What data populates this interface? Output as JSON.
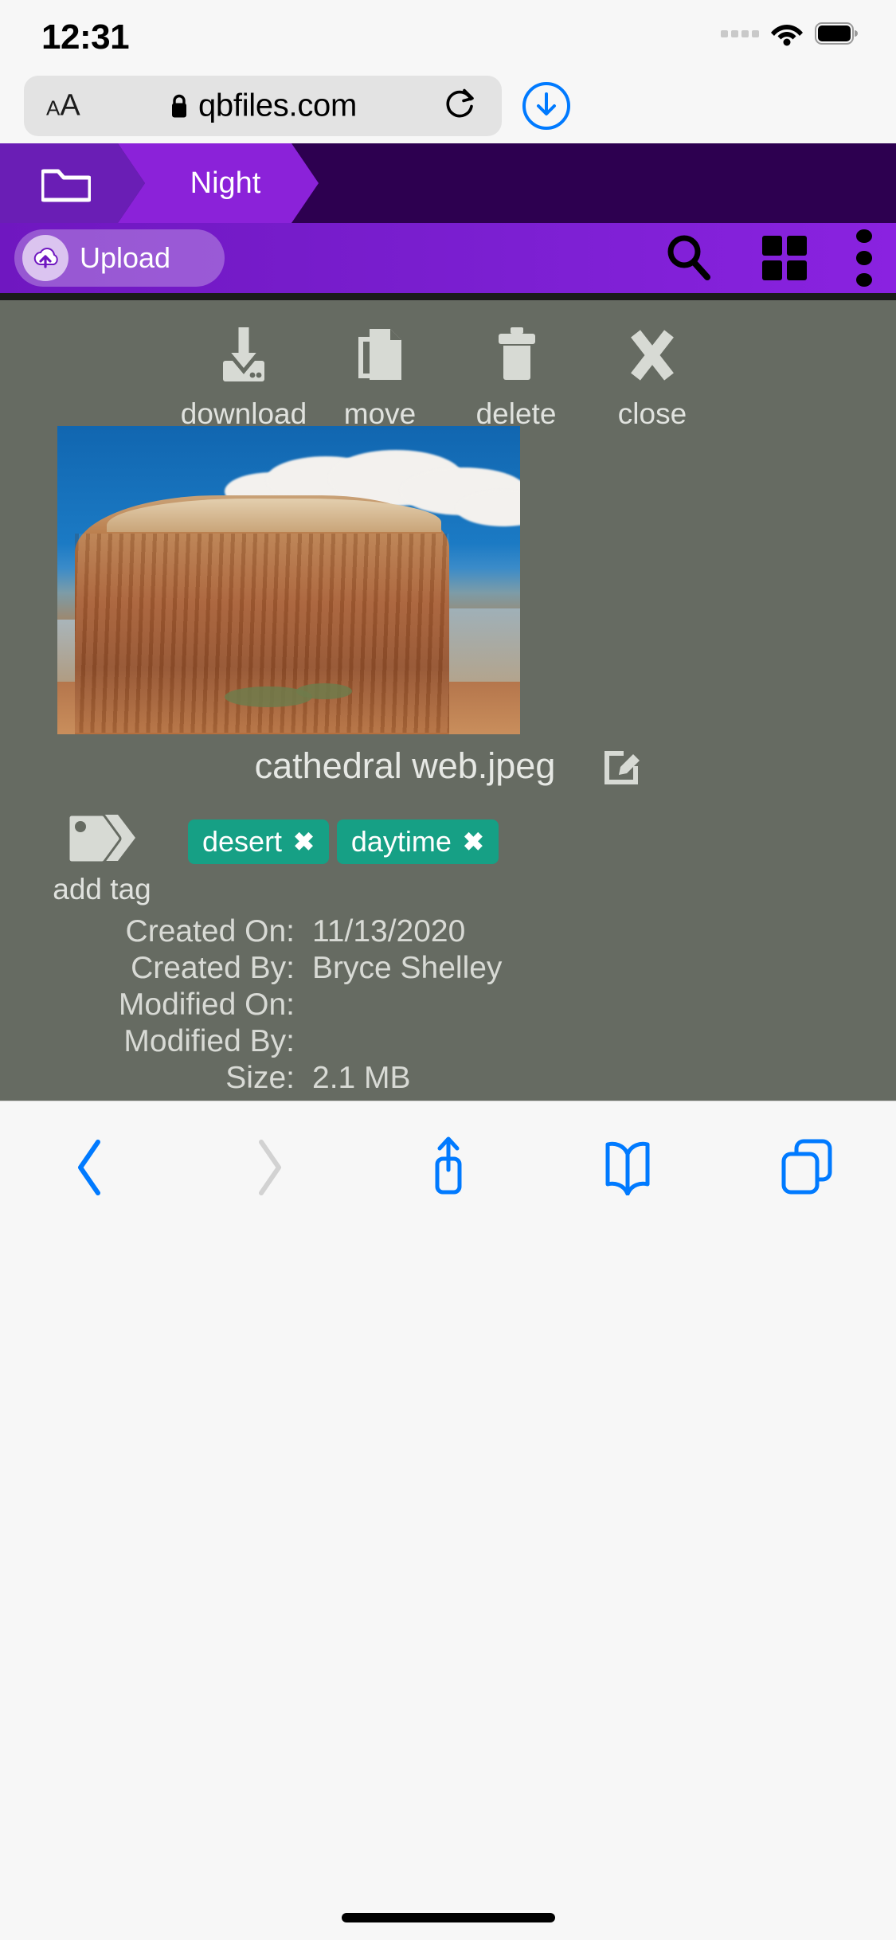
{
  "status_bar": {
    "time": "12:31",
    "wifi_icon": "wifi-icon",
    "battery_icon": "battery-icon",
    "signal_icon": "signal-dots-icon"
  },
  "browser": {
    "text_size_label_small": "A",
    "text_size_label_large": "A",
    "lock_icon": "lock-icon",
    "url": "qbfiles.com",
    "reload_icon": "reload-icon",
    "downloads_icon": "downloads-icon"
  },
  "breadcrumb": {
    "home_icon": "folder-icon",
    "items": [
      {
        "label": "Night"
      }
    ]
  },
  "app_toolbar": {
    "upload_label": "Upload",
    "upload_icon": "cloud-upload-icon",
    "search_icon": "search-icon",
    "grid_icon": "grid-view-icon",
    "menu_icon": "kebab-menu-icon"
  },
  "file_actions": [
    {
      "label": "download",
      "icon": "download-icon"
    },
    {
      "label": "move",
      "icon": "copy-move-icon"
    },
    {
      "label": "delete",
      "icon": "trash-icon"
    },
    {
      "label": "close",
      "icon": "close-x-icon"
    }
  ],
  "file": {
    "name": "cathedral web.jpeg",
    "edit_icon": "edit-pencil-icon",
    "preview_icon": "image-preview",
    "add_tag_label": "add tag",
    "add_tag_icon": "tags-icon",
    "tags": [
      {
        "label": "desert",
        "remove_icon": "remove-tag-icon"
      },
      {
        "label": "daytime",
        "remove_icon": "remove-tag-icon"
      }
    ],
    "metadata": [
      {
        "key": "Created On:",
        "value": "11/13/2020"
      },
      {
        "key": "Created By:",
        "value": "Bryce Shelley"
      },
      {
        "key": "Modified On:",
        "value": ""
      },
      {
        "key": "Modified By:",
        "value": ""
      },
      {
        "key": "Size:",
        "value": "2.1 MB"
      }
    ]
  },
  "safari_toolbar": {
    "back_icon": "back-chevron-icon",
    "forward_icon": "forward-chevron-icon",
    "share_icon": "share-icon",
    "bookmarks_icon": "bookmarks-icon",
    "tabs_icon": "tabs-icon"
  },
  "colors": {
    "accent_purple": "#7b1fd1",
    "breadcrumb_active": "#8b22d9",
    "breadcrumb_dark": "#2d0050",
    "panel_gray": "#666b62",
    "tag_green": "#16a085",
    "safari_blue": "#007aff"
  }
}
